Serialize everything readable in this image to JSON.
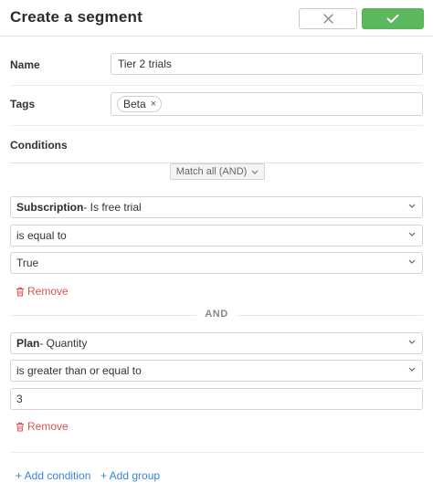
{
  "header": {
    "title": "Create a segment",
    "cancel_icon": "close-icon",
    "save_icon": "check-icon",
    "accent_color": "#5cb85c"
  },
  "name": {
    "label": "Name",
    "value": "Tier 2 trials"
  },
  "tags": {
    "label": "Tags",
    "items": [
      {
        "label": "Beta"
      }
    ],
    "remove_glyph": "×"
  },
  "conditions": {
    "label": "Conditions",
    "match_mode": "Match all (AND)",
    "groups": [
      {
        "field_bold": "Subscription",
        "field_rest": " - Is free trial",
        "operator": "is equal to",
        "value": "True",
        "remove_label": "Remove"
      },
      {
        "field_bold": "Plan",
        "field_rest": " - Quantity",
        "operator": "is greater than or equal to",
        "value": "3",
        "remove_label": "Remove"
      }
    ],
    "separator": "AND",
    "add_condition_label": "+ Add condition",
    "add_group_label": "+ Add group",
    "link_color": "#3a83d6",
    "remove_color": "#d9534f"
  }
}
